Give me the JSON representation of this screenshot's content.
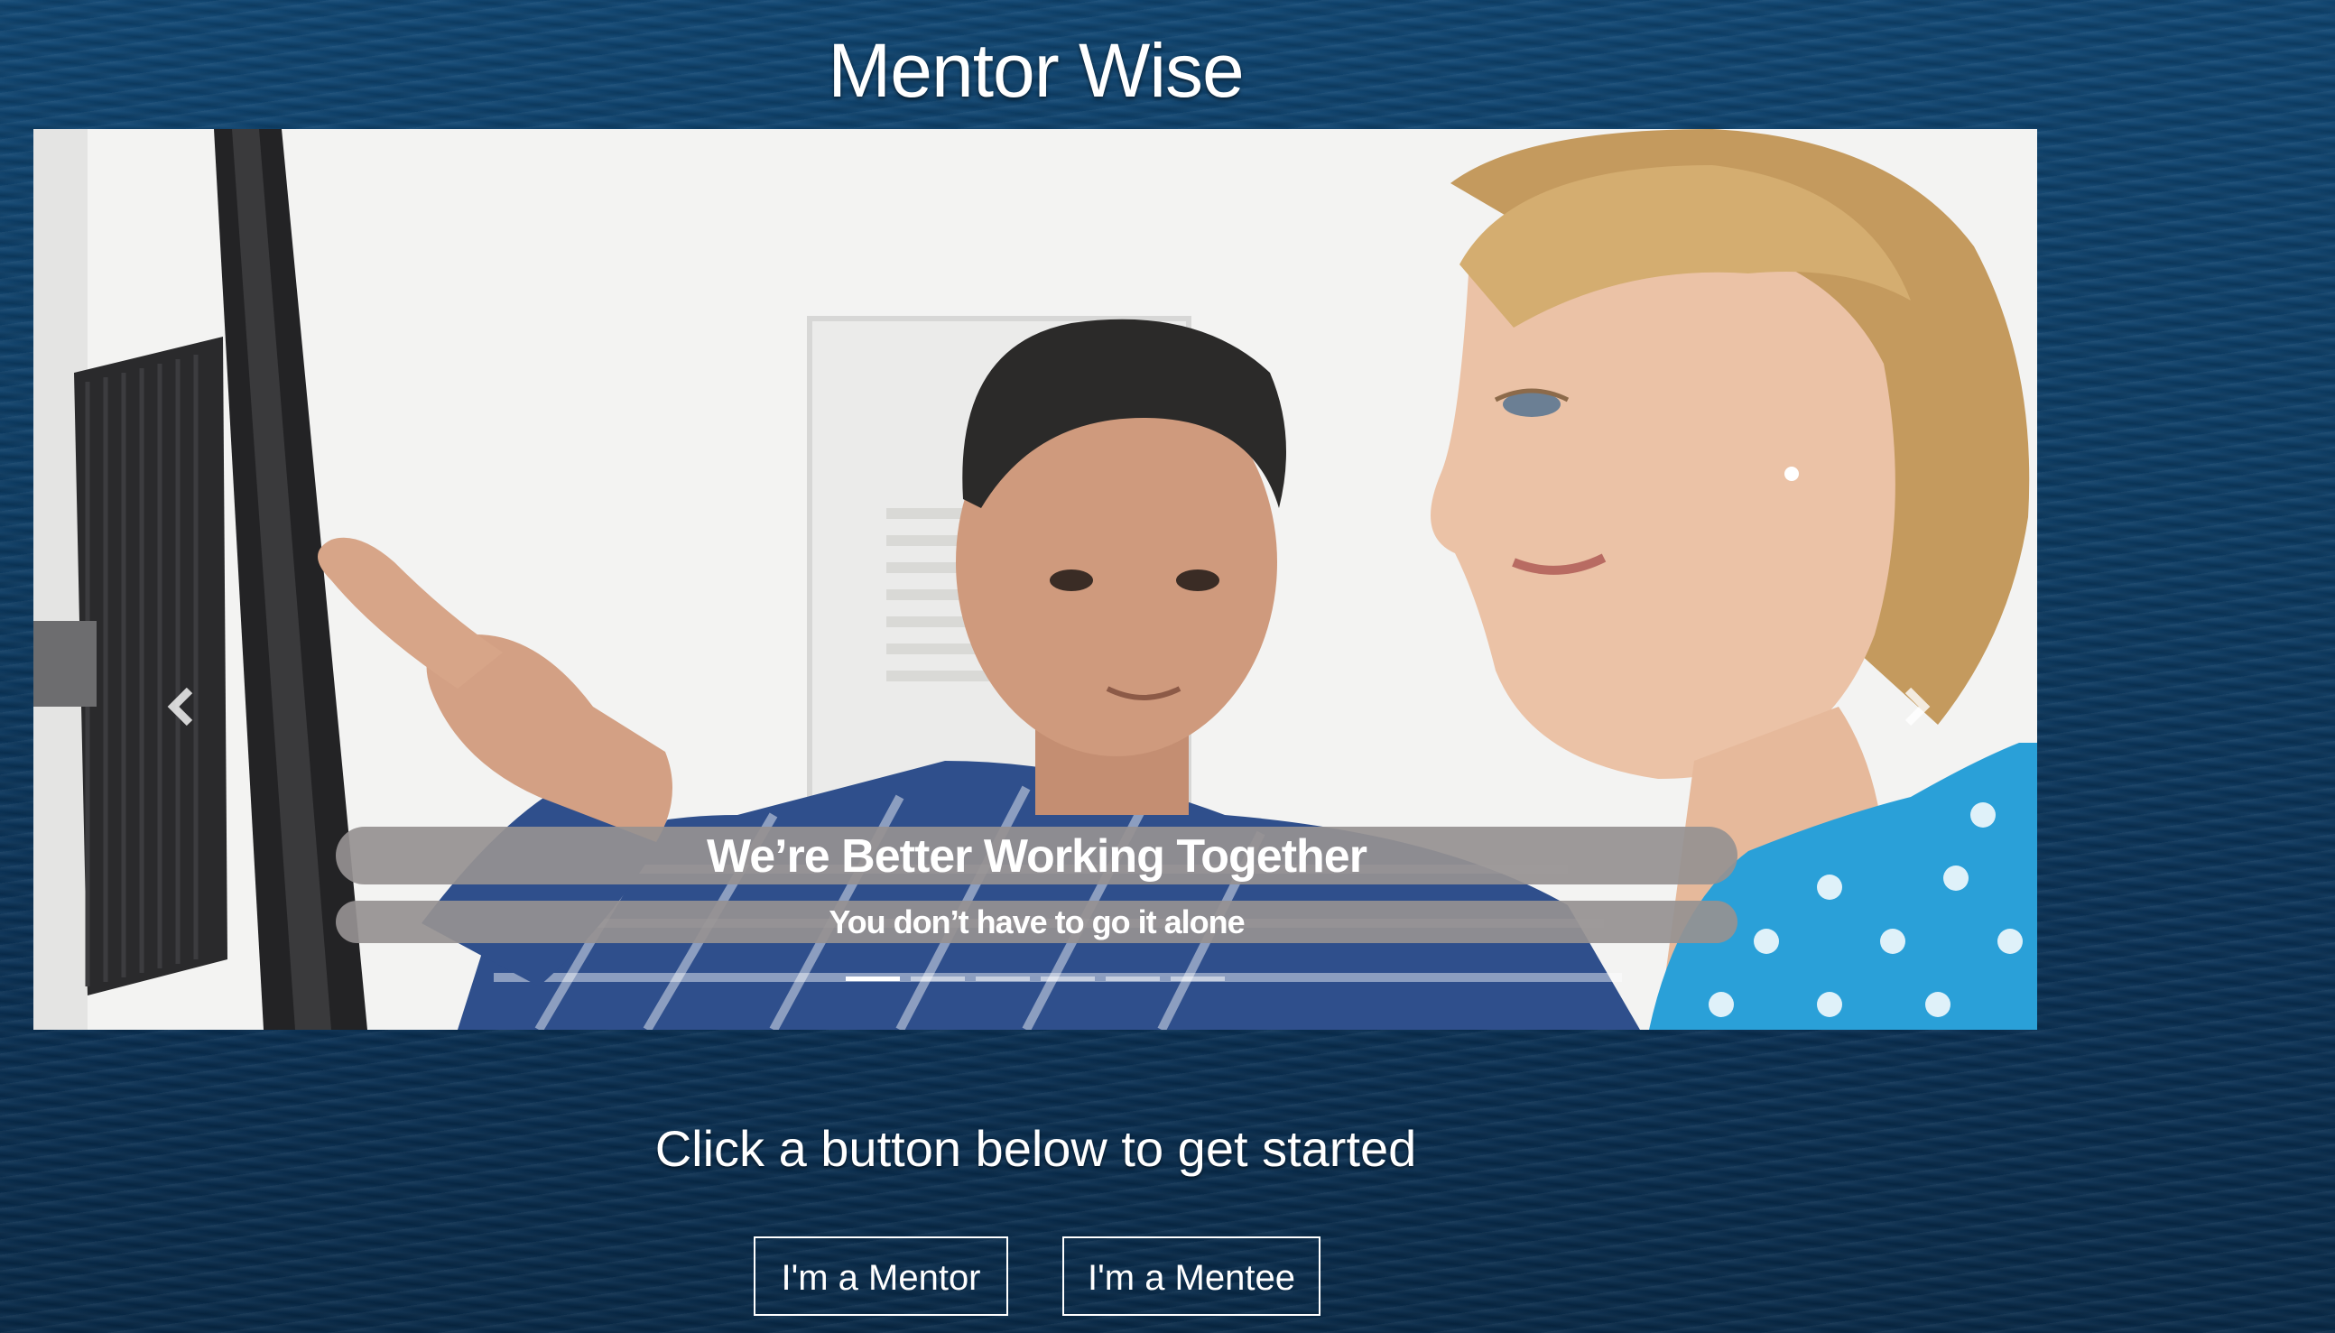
{
  "header": {
    "title": "Mentor Wise"
  },
  "carousel": {
    "caption_title": "We’re Better Working Together",
    "caption_subtitle": "You don’t have to go it alone",
    "prev_icon": "chevron-left-icon",
    "next_icon": "chevron-right-icon",
    "slide_count": 6,
    "active_slide": 1
  },
  "main": {
    "prompt": "Click a button below to get started",
    "buttons": [
      {
        "label": "I'm a Mentor"
      },
      {
        "label": "I'm a Mentee"
      }
    ]
  },
  "colors": {
    "background": "#0c3c64",
    "caption_bg": "#969191",
    "text": "#ffffff"
  }
}
